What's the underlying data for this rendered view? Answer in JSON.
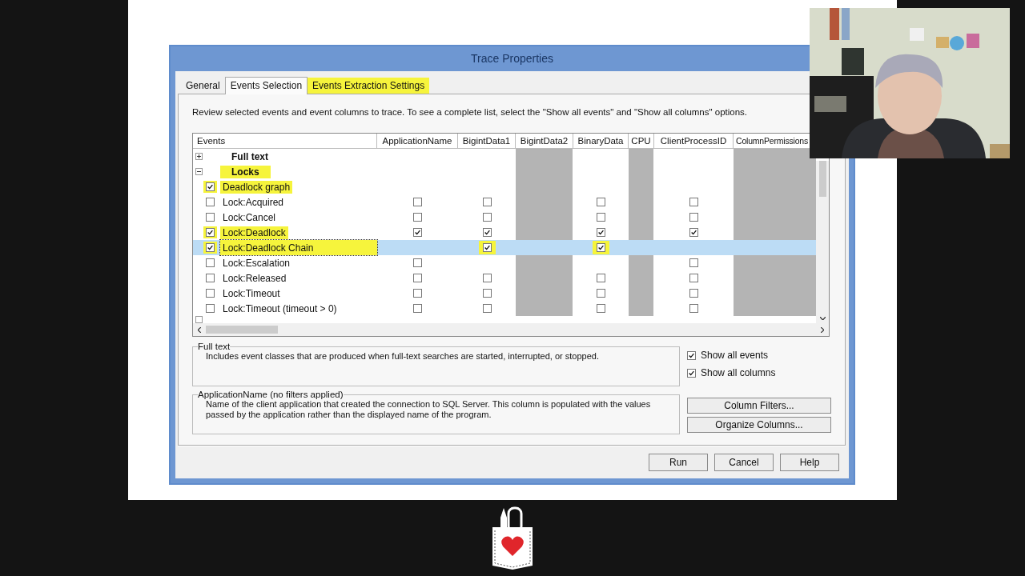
{
  "window": {
    "title": "Trace Properties"
  },
  "tabs": [
    {
      "label": "General",
      "selected": false,
      "highlighted": false
    },
    {
      "label": "Events Selection",
      "selected": true,
      "highlighted": false
    },
    {
      "label": "Events Extraction Settings",
      "selected": false,
      "highlighted": true
    }
  ],
  "instructions": "Review selected events and event columns to trace. To see a complete list, select the \"Show all events\" and \"Show all columns\" options.",
  "table": {
    "columns": [
      "Events",
      "ApplicationName",
      "BigintData1",
      "BigintData2",
      "BinaryData",
      "CPU",
      "ClientProcessID",
      "ColumnPermissions"
    ],
    "rows": [
      {
        "kind": "group",
        "name": "Full text",
        "expanded": false,
        "highlighted": false,
        "selected": false,
        "cells": [
          {
            "kind": "empty"
          },
          {
            "kind": "empty"
          },
          {
            "kind": "grey"
          },
          {
            "kind": "empty"
          },
          {
            "kind": "grey"
          },
          {
            "kind": "empty"
          },
          {
            "kind": "grey"
          }
        ]
      },
      {
        "kind": "group",
        "name": "Locks",
        "expanded": true,
        "highlighted": true,
        "selected": false,
        "cells": [
          {
            "kind": "empty"
          },
          {
            "kind": "empty"
          },
          {
            "kind": "grey"
          },
          {
            "kind": "empty"
          },
          {
            "kind": "grey"
          },
          {
            "kind": "empty"
          },
          {
            "kind": "grey"
          }
        ]
      },
      {
        "kind": "event",
        "name": "Deadlock graph",
        "checked": true,
        "highlighted": true,
        "selected": false,
        "cells": [
          {
            "kind": "empty"
          },
          {
            "kind": "empty"
          },
          {
            "kind": "grey"
          },
          {
            "kind": "empty"
          },
          {
            "kind": "grey"
          },
          {
            "kind": "empty"
          },
          {
            "kind": "grey"
          }
        ]
      },
      {
        "kind": "event",
        "name": "Lock:Acquired",
        "checked": false,
        "highlighted": false,
        "selected": false,
        "cells": [
          {
            "kind": "checkbox",
            "checked": false
          },
          {
            "kind": "checkbox",
            "checked": false
          },
          {
            "kind": "grey"
          },
          {
            "kind": "checkbox",
            "checked": false
          },
          {
            "kind": "grey"
          },
          {
            "kind": "checkbox",
            "checked": false
          },
          {
            "kind": "grey"
          }
        ]
      },
      {
        "kind": "event",
        "name": "Lock:Cancel",
        "checked": false,
        "highlighted": false,
        "selected": false,
        "cells": [
          {
            "kind": "checkbox",
            "checked": false
          },
          {
            "kind": "checkbox",
            "checked": false
          },
          {
            "kind": "grey"
          },
          {
            "kind": "checkbox",
            "checked": false
          },
          {
            "kind": "grey"
          },
          {
            "kind": "checkbox",
            "checked": false
          },
          {
            "kind": "grey"
          }
        ]
      },
      {
        "kind": "event",
        "name": "Lock:Deadlock",
        "checked": true,
        "highlighted": true,
        "selected": false,
        "cells": [
          {
            "kind": "checkbox",
            "checked": true
          },
          {
            "kind": "checkbox",
            "checked": true
          },
          {
            "kind": "grey"
          },
          {
            "kind": "checkbox",
            "checked": true
          },
          {
            "kind": "grey"
          },
          {
            "kind": "checkbox",
            "checked": true
          },
          {
            "kind": "grey"
          }
        ]
      },
      {
        "kind": "event",
        "name": "Lock:Deadlock Chain",
        "checked": true,
        "highlighted": true,
        "selected": true,
        "cells": [
          {
            "kind": "empty"
          },
          {
            "kind": "checkbox",
            "checked": true,
            "highlighted": true
          },
          {
            "kind": "empty"
          },
          {
            "kind": "checkbox",
            "checked": true,
            "highlighted": true
          },
          {
            "kind": "empty"
          },
          {
            "kind": "empty"
          },
          {
            "kind": "empty"
          }
        ]
      },
      {
        "kind": "event",
        "name": "Lock:Escalation",
        "checked": false,
        "highlighted": false,
        "selected": false,
        "cells": [
          {
            "kind": "checkbox",
            "checked": false
          },
          {
            "kind": "empty"
          },
          {
            "kind": "grey"
          },
          {
            "kind": "empty"
          },
          {
            "kind": "grey"
          },
          {
            "kind": "checkbox",
            "checked": false
          },
          {
            "kind": "grey"
          }
        ]
      },
      {
        "kind": "event",
        "name": "Lock:Released",
        "checked": false,
        "highlighted": false,
        "selected": false,
        "cells": [
          {
            "kind": "checkbox",
            "checked": false
          },
          {
            "kind": "checkbox",
            "checked": false
          },
          {
            "kind": "grey"
          },
          {
            "kind": "checkbox",
            "checked": false
          },
          {
            "kind": "grey"
          },
          {
            "kind": "checkbox",
            "checked": false
          },
          {
            "kind": "grey"
          }
        ]
      },
      {
        "kind": "event",
        "name": "Lock:Timeout",
        "checked": false,
        "highlighted": false,
        "selected": false,
        "cells": [
          {
            "kind": "checkbox",
            "checked": false
          },
          {
            "kind": "checkbox",
            "checked": false
          },
          {
            "kind": "grey"
          },
          {
            "kind": "checkbox",
            "checked": false
          },
          {
            "kind": "grey"
          },
          {
            "kind": "checkbox",
            "checked": false
          },
          {
            "kind": "grey"
          }
        ]
      },
      {
        "kind": "event",
        "name": "Lock:Timeout (timeout > 0)",
        "checked": false,
        "highlighted": false,
        "selected": false,
        "cells": [
          {
            "kind": "checkbox",
            "checked": false
          },
          {
            "kind": "checkbox",
            "checked": false
          },
          {
            "kind": "grey"
          },
          {
            "kind": "checkbox",
            "checked": false
          },
          {
            "kind": "grey"
          },
          {
            "kind": "checkbox",
            "checked": false
          },
          {
            "kind": "grey"
          }
        ]
      }
    ]
  },
  "event_group": {
    "title": "Full text",
    "description": "Includes event classes that are produced when full-text searches are started, interrupted, or stopped."
  },
  "column_group": {
    "title": "ApplicationName (no filters applied)",
    "description": "Name of the client application that created the connection to SQL Server. This column is populated with the values passed by the application rather than the displayed name of the program."
  },
  "options": [
    {
      "label": "Show all events",
      "checked": true
    },
    {
      "label": "Show all columns",
      "checked": true
    }
  ],
  "side_buttons": [
    "Column Filters...",
    "Organize Columns..."
  ],
  "buttons": [
    "Run",
    "Cancel",
    "Help"
  ],
  "webcam": {
    "kind": "picture"
  }
}
